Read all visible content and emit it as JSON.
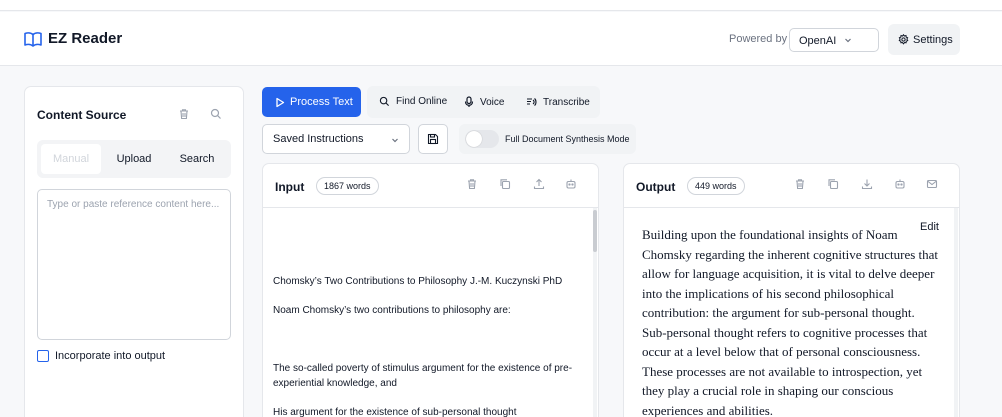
{
  "app": {
    "title": "EZ Reader",
    "powered_by_label": "Powered by",
    "provider": "OpenAI",
    "settings_label": "Settings"
  },
  "source": {
    "title": "Content Source",
    "tabs": [
      "Manual",
      "Upload",
      "Search"
    ],
    "active_tab": "Manual",
    "textarea_placeholder": "Type or paste reference content here...",
    "checkbox_label": "Incorporate into output",
    "checkbox_checked": false
  },
  "toolbar": {
    "process_label": "Process Text",
    "find_online_label": "Find Online",
    "voice_label": "Voice",
    "transcribe_label": "Transcribe",
    "instructions_value": "Saved Instructions",
    "synthesis_label": "Full Document Synthesis Mode",
    "synthesis_on": false
  },
  "input": {
    "title": "Input",
    "word_count": "1867 words",
    "paragraphs": [
      "Chomsky’s Two Contributions to Philosophy J.-M. Kuczynski PhD",
      "Noam Chomsky’s two contributions to philosophy are:",
      "",
      "The so-called poverty of stimulus argument for the existence of pre- experiential knowledge, and",
      "His argument for the existence of sub-personal thought"
    ]
  },
  "output": {
    "title": "Output",
    "word_count": "449 words",
    "edit_label": "Edit",
    "text": "Building upon the foundational insights of Noam Chomsky regarding the inherent cognitive structures that allow for language acquisition, it is vital to delve deeper into the implications of his second philosophical contribution: the argument for sub-personal thought. Sub-personal thought refers to cognitive processes that occur at a level below that of personal consciousness. These processes are not available to introspection, yet they play a crucial role in shaping our conscious experiences and abilities."
  },
  "colors": {
    "accent": "#2563eb",
    "panel_bg": "#ffffff",
    "page_bg": "#f7f8fa"
  }
}
